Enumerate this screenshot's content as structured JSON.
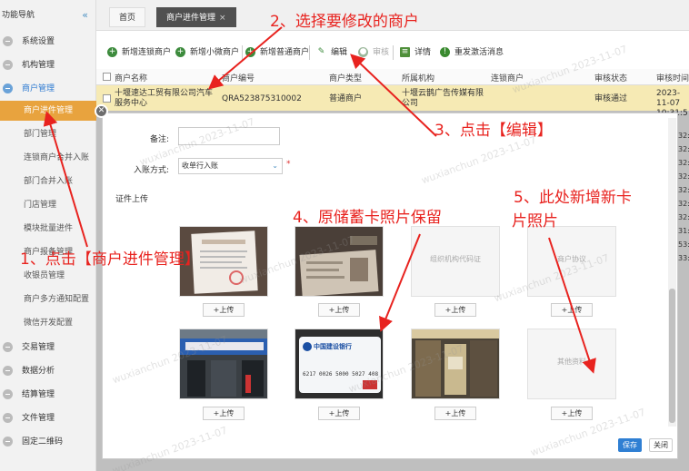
{
  "sidebar": {
    "title": "功能导航",
    "collapse_icon": "«",
    "groups": [
      {
        "label": "系统设置"
      },
      {
        "label": "机构管理"
      },
      {
        "label": "商户管理"
      },
      {
        "label": "交易管理"
      },
      {
        "label": "数据分析"
      },
      {
        "label": "结算管理"
      },
      {
        "label": "文件管理"
      },
      {
        "label": "固定二维码"
      }
    ],
    "items": [
      {
        "label": "商户进件管理"
      },
      {
        "label": "部门管理"
      },
      {
        "label": "连锁商户合并入账"
      },
      {
        "label": "部门合并入账"
      },
      {
        "label": "门店管理"
      },
      {
        "label": "模块批量进件"
      },
      {
        "label": "商户报备管理"
      },
      {
        "label": "收银员管理"
      },
      {
        "label": "商户多方通知配置"
      },
      {
        "label": "微信开发配置"
      }
    ]
  },
  "tabs": [
    {
      "label": "首页"
    },
    {
      "label": "商户进件管理",
      "close": "×"
    }
  ],
  "toolbar": {
    "buttons": [
      {
        "label": "新增连锁商户"
      },
      {
        "label": "新增小微商户"
      },
      {
        "label": "新增普通商户"
      },
      {
        "label": "编辑"
      },
      {
        "label": "审核"
      },
      {
        "label": "详情"
      },
      {
        "label": "重发激活消息"
      }
    ]
  },
  "grid": {
    "headers": [
      "商户名称",
      "商户编号",
      "商户类型",
      "所属机构",
      "连锁商户",
      "审核状态",
      "审核时间"
    ],
    "row": {
      "name": "十堰速达工贸有限公司汽车服务中心",
      "id": "QRA523875310002",
      "type": "普通商户",
      "org": "十堰云鹊广告传媒有限公司",
      "chain": "",
      "status": "审核通过",
      "time": "2023-11-07 10:31:5"
    },
    "side_times": [
      "32:5",
      "32:4",
      "32:5",
      "32:4",
      "32:4",
      "32:3",
      "32:4",
      "31:4",
      "53:3",
      "33:0"
    ]
  },
  "form": {
    "remark_label": "备注:",
    "remark_value": "",
    "entry_label": "入账方式:",
    "entry_value": "收单行入账",
    "required_mark": "*",
    "section_title": "证件上传",
    "photos": [
      {
        "label": "",
        "upload": "+上传",
        "icon": "license-photo"
      },
      {
        "label": "",
        "upload": "+上传",
        "icon": "idcard-photo"
      },
      {
        "label": "组织机构代码证",
        "upload": "+上传",
        "icon": "placeholder"
      },
      {
        "label": "商户协议",
        "upload": "+上传",
        "icon": "placeholder"
      },
      {
        "label": "",
        "upload": "+上传",
        "icon": "storefront-photo"
      },
      {
        "label": "",
        "upload": "+上传",
        "icon": "bankcard-photo"
      },
      {
        "label": "",
        "upload": "+上传",
        "icon": "shop-interior-photo"
      },
      {
        "label": "其他资料",
        "upload": "+上传",
        "icon": "placeholder"
      }
    ],
    "bank_card": {
      "bank": "中国建设银行",
      "number": "6217 0026 5000 5027 408"
    },
    "save_label": "保存",
    "close_label": "关闭"
  },
  "annotations": [
    {
      "text": "1、点击【商户进件管理】"
    },
    {
      "text": "2、选择要修改的商户"
    },
    {
      "text": "3、点击【编辑】"
    },
    {
      "text": "4、原储蓄卡照片保留"
    },
    {
      "text": "5、此处新增新卡"
    },
    {
      "text": "片照片"
    }
  ],
  "watermark": "wuxianchun 2023-11-07",
  "colors": {
    "accent": "#e8a33e",
    "annotation": "#e8231f",
    "primary": "#2f7fd3"
  }
}
